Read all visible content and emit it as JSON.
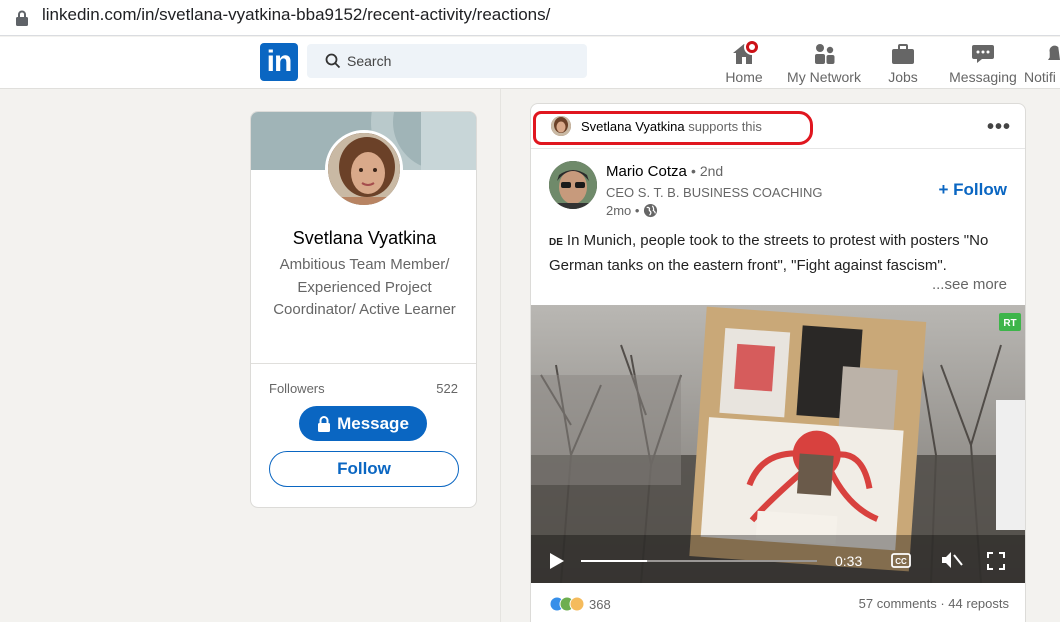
{
  "browser": {
    "url": "linkedin.com/in/svetlana-vyatkina-bba9152/recent-activity/reactions/"
  },
  "nav": {
    "logo_text": "in",
    "search_placeholder": "Search",
    "items": [
      {
        "label": "Home",
        "icon": "home-icon"
      },
      {
        "label": "My Network",
        "icon": "network-icon"
      },
      {
        "label": "Jobs",
        "icon": "briefcase-icon"
      },
      {
        "label": "Messaging",
        "icon": "messaging-icon"
      },
      {
        "label": "Notifi",
        "icon": "bell-icon"
      }
    ]
  },
  "profile": {
    "name": "Svetlana Vyatkina",
    "headline": "Ambitious Team Member/ Experienced Project Coordinator/ Active Learner",
    "followers_label": "Followers",
    "followers_count": "522",
    "message_label": "Message",
    "follow_label": "Follow"
  },
  "post": {
    "context_name": "Svetlana Vyatkina",
    "context_action": "supports this",
    "more_label": "•••",
    "author_name": "Mario Cotza",
    "author_degree": "• 2nd",
    "author_title": "CEO S. T. B. BUSINESS COACHING",
    "time": "2mo •",
    "follow_label": "+ Follow",
    "flag": "DE",
    "text": "In Munich, people took to the streets to protest with posters \"No German tanks on the eastern front\", \"Fight against fascism\".",
    "see_more": "...see more",
    "video": {
      "badge": "RT",
      "time": "0:33",
      "progress": 0.28,
      "cc_label": "CC"
    },
    "reactions_count": "368",
    "comments": "57 comments",
    "reposts": "44 reposts"
  },
  "colors": {
    "brand": "#0a66c2",
    "highlight": "#e0161f",
    "badge": "#cc1016"
  }
}
